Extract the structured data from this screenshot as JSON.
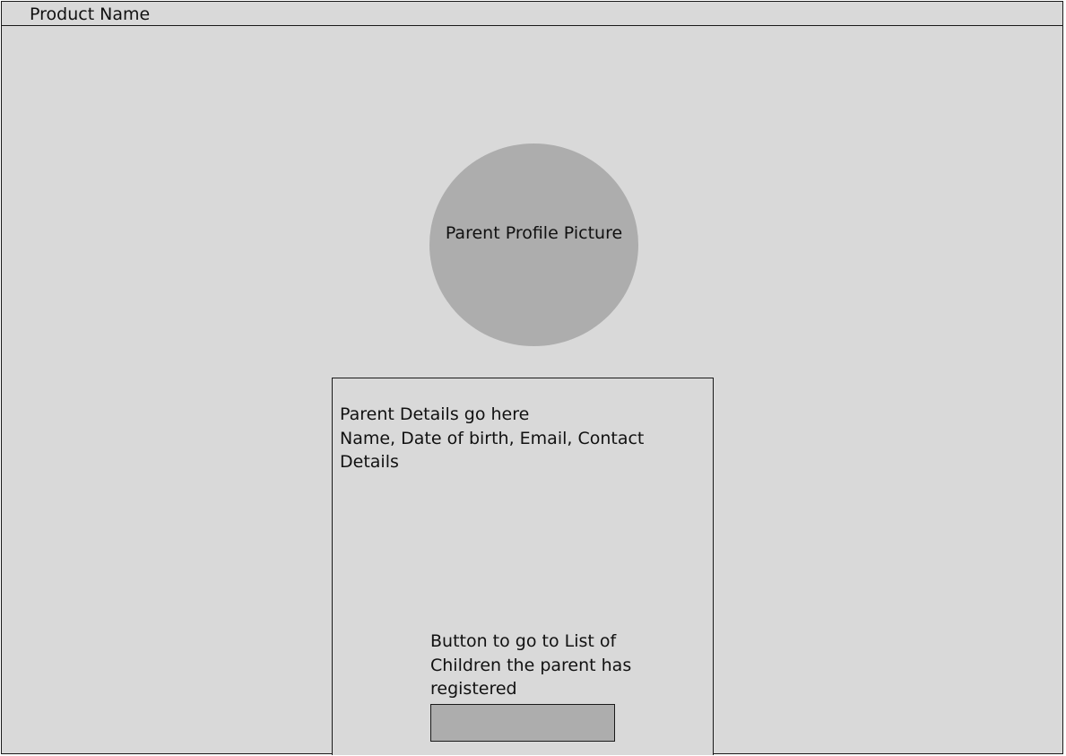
{
  "header": {
    "product_name": "Product Name"
  },
  "profile": {
    "picture_label": "Parent Profile Picture"
  },
  "details": {
    "heading": "Parent Details go here",
    "fields": "Name, Date of birth, Email, Contact Details"
  },
  "children_button": {
    "caption": "Button to go to List of Children the parent has registered",
    "label": ""
  },
  "colors": {
    "background": "#d9d9d9",
    "placeholder_fill": "#adadad",
    "border": "#1a1a1a"
  }
}
